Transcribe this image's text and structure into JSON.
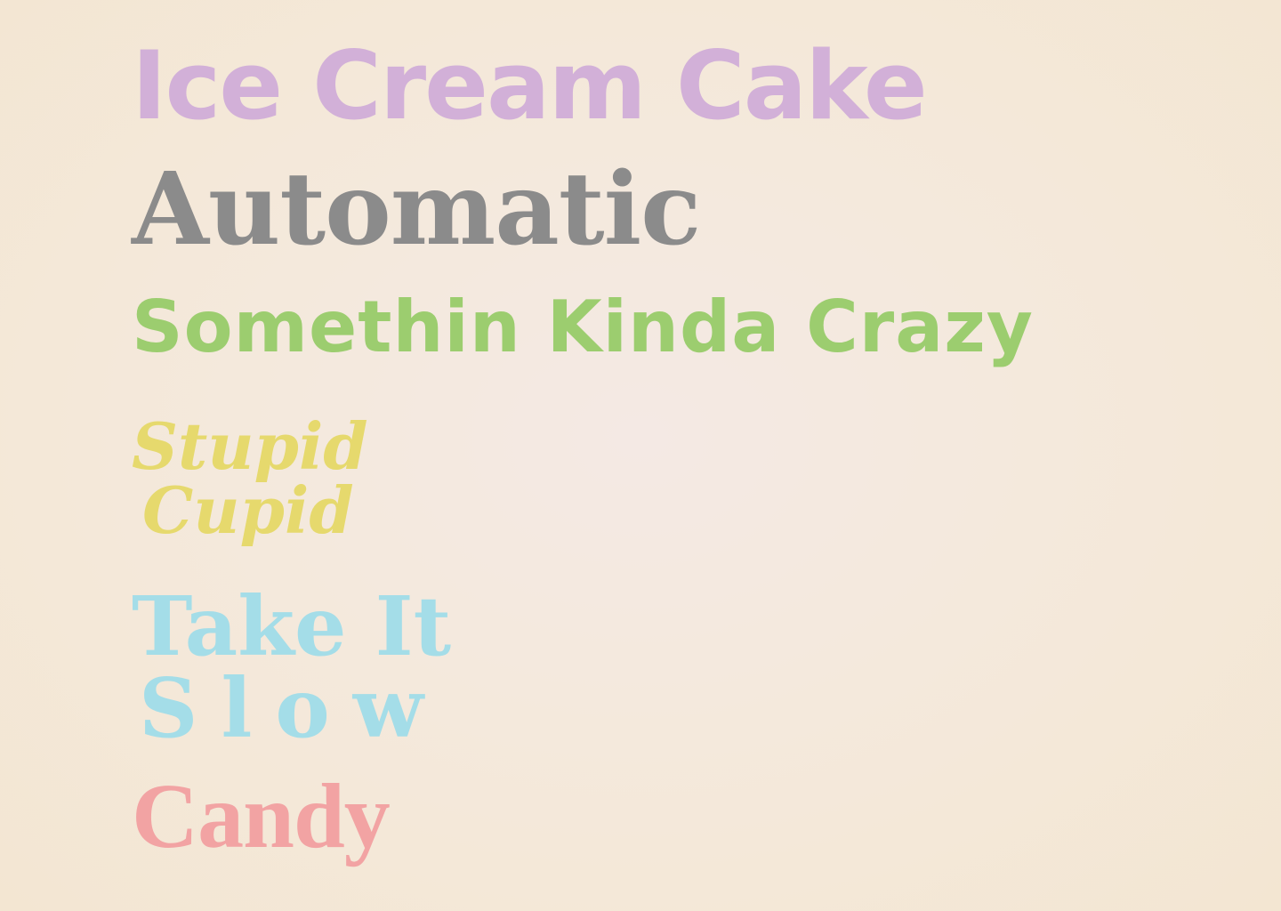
{
  "titles": {
    "ice_cream_cake": "Ice Cream Cake",
    "automatic": "Automatic",
    "somethin_kinda_crazy": "Somethin Kinda Crazy",
    "stupid_cupid": {
      "line1": "Stupid",
      "line2": "Cupid"
    },
    "take_it_slow": {
      "line1": "Take It",
      "line2": "Slow"
    },
    "candy": "Candy"
  },
  "colors": {
    "background": "#f4e9dc",
    "ice_cream_cake": "#d2b0d8",
    "automatic": "#8b8b8b",
    "somethin_kinda_crazy": "#9ccd6f",
    "stupid_cupid": "#e6d96d",
    "take_it_slow": "#a4dde8",
    "candy": "#f2a3a3"
  }
}
